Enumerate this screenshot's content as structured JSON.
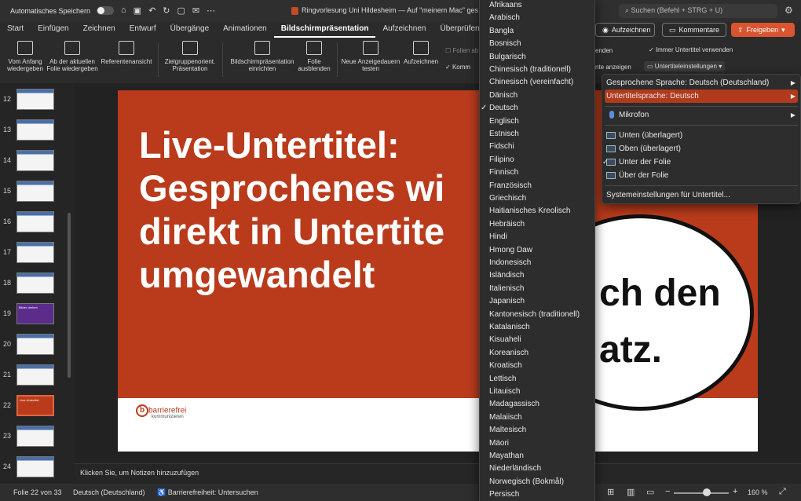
{
  "titlebar": {
    "autosave_label": "Automatisches Speichern",
    "doc_title": "Ringvorlesung Uni Hildesheim — Auf \"meinem Mac\" ges",
    "search_placeholder": "Suchen (Befehl + STRG + U)"
  },
  "tabs": [
    "Start",
    "Einfügen",
    "Zeichnen",
    "Entwurf",
    "Übergänge",
    "Animationen",
    "Bildschirmpräsentation",
    "Aufzeichnen",
    "Überprüfen"
  ],
  "header_buttons": {
    "record": "Aufzeichnen",
    "comments": "Kommentare",
    "share": "Freigeben"
  },
  "ribbon": {
    "from_start": "Vom Anfang\nwiedergeben",
    "from_current": "Ab der aktuellen\nFolie wiedergeben",
    "presenter": "Referentenansicht",
    "custom": "Zielgruppenorient.\nPräsentation",
    "setup": "Bildschirmpräsentation\neinrichten",
    "hide": "Folie\nausblenden",
    "rehearse": "Neue Anzeigedauern\ntesten",
    "record": "Aufzeichnen",
    "play_narrations": "Folien ab",
    "use_timings": "Komm",
    "always_subtitles": "Immer Untertitel verwenden",
    "show_frag": "enden",
    "show_frag2": "nte anzeigen",
    "subtitle_settings": "Untertiteleinstellungen"
  },
  "thumbnails": [
    {
      "num": "12"
    },
    {
      "num": "13"
    },
    {
      "num": "14"
    },
    {
      "num": "15"
    },
    {
      "num": "16"
    },
    {
      "num": "17"
    },
    {
      "num": "18"
    },
    {
      "num": "19",
      "label": "Bilder drehen"
    },
    {
      "num": "20"
    },
    {
      "num": "21"
    },
    {
      "num": "22",
      "label": "Live-Untertitel",
      "selected": true
    },
    {
      "num": "23"
    },
    {
      "num": "24"
    }
  ],
  "slide": {
    "title": "Live-Untertitel:\nGesprochenes wi\ndirekt in Untertite\numgewandelt",
    "oval_text": "ch den\natz.",
    "logo_word": "barrierefrei",
    "logo_sub": "kommunizieren",
    "logo_letter": "b"
  },
  "notes_placeholder": "Klicken Sie, um Notizen hinzuzufügen",
  "status": {
    "slide_count": "Folie 22 von 33",
    "language": "Deutsch (Deutschland)",
    "accessibility": "Barrierefreiheit: Untersuchen",
    "zoom": "160 %"
  },
  "languages": [
    "Afrikaans",
    "Arabisch",
    "Bangla",
    "Bosnisch",
    "Bulgarisch",
    "Chinesisch (traditionell)",
    "Chinesisch (vereinfacht)",
    "Dänisch",
    "Deutsch",
    "Englisch",
    "Estnisch",
    "Fidschi",
    "Filipino",
    "Finnisch",
    "Französisch",
    "Griechisch",
    "Haitianisches Kreolisch",
    "Hebräisch",
    "Hindi",
    "Hmong Daw",
    "Indonesisch",
    "Isländisch",
    "Italienisch",
    "Japanisch",
    "Kantonesisch (traditionell)",
    "Katalanisch",
    "Kisuaheli",
    "Koreanisch",
    "Kroatisch",
    "Lettisch",
    "Litauisch",
    "Madagassisch",
    "Malaiisch",
    "Maltesisch",
    "Mäori",
    "Mayathan",
    "Niederländisch",
    "Norwegisch (Bokmål)",
    "Persisch"
  ],
  "selected_language": "Deutsch",
  "submenu": {
    "spoken": "Gesprochene Sprache: Deutsch (Deutschland)",
    "subtitle_lang": "Untertitelsprache: Deutsch",
    "mic": "Mikrofon",
    "pos_bottom": "Unten (überlagert)",
    "pos_top": "Oben (überlagert)",
    "pos_below": "Unter der Folie",
    "pos_above": "Über der Folie",
    "system": "Systemeinstellungen für Untertitel..."
  },
  "colors": {
    "accent": "#b13a1c",
    "slide_red": "#b93b1c",
    "share": "#d9542f"
  },
  "icons": [
    "home-icon",
    "save-icon",
    "undo-icon",
    "redo-icon",
    "new-doc-icon",
    "mail-icon",
    "more-icon",
    "search-icon",
    "settings-icon",
    "record-dot-icon",
    "comment-icon",
    "share-icon",
    "checkmark-icon",
    "chevron-right-icon",
    "microphone-icon"
  ]
}
